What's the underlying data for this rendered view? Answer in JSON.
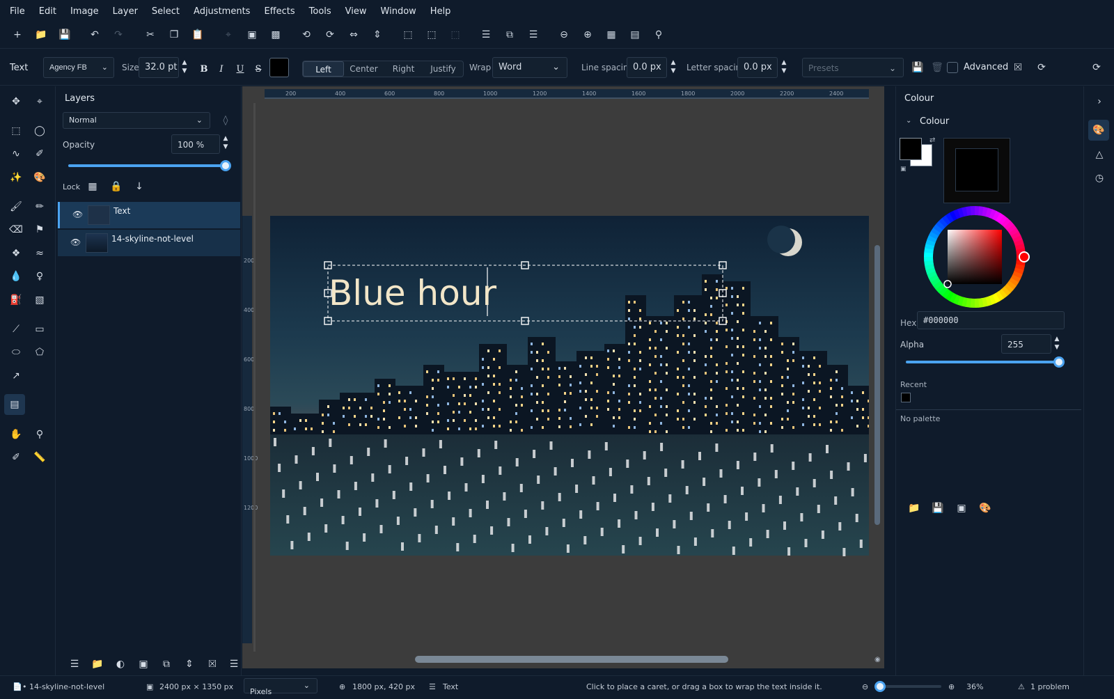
{
  "menu": [
    "File",
    "Edit",
    "Image",
    "Layer",
    "Select",
    "Adjustments",
    "Effects",
    "Tools",
    "View",
    "Window",
    "Help"
  ],
  "options": {
    "tool_label": "Text",
    "font": "Agency FB",
    "size_label": "Size",
    "size_value": "32.0 pt",
    "align": [
      "Left",
      "Center",
      "Right",
      "Justify"
    ],
    "wrap_label": "Wrap",
    "wrap_value": "Word",
    "line_spacing_label": "Line spacing",
    "line_spacing_value": "0.0 px",
    "letter_spacing_label": "Letter spacing",
    "letter_spacing_value": "0.0 px",
    "presets_placeholder": "Presets",
    "advanced_label": "Advanced"
  },
  "layers": {
    "title": "Layers",
    "blend_mode": "Normal",
    "opacity_label": "Opacity",
    "opacity_value": "100 %",
    "opacity_fraction": 1.0,
    "lock_label": "Lock",
    "items": [
      {
        "name": "Text"
      },
      {
        "name": "14-skyline-not-level"
      }
    ]
  },
  "ruler": {
    "h": [
      "200",
      "400",
      "600",
      "800",
      "1000",
      "1200",
      "1400",
      "1600",
      "1800",
      "2000",
      "2200",
      "2400"
    ],
    "v": [
      "200",
      "400",
      "600",
      "800",
      "1000",
      "1200"
    ]
  },
  "canvas_text": "Blue hour",
  "colour": {
    "panel_title": "Colour",
    "section_title": "Colour",
    "hex_label": "Hex",
    "hex_value": "#000000",
    "alpha_label": "Alpha",
    "alpha_value": "255",
    "recent_label": "Recent",
    "no_palette": "No palette",
    "primary": "#000000",
    "secondary": "#ffffff"
  },
  "status": {
    "document": "• 14-skyline-not-level",
    "dimensions": "2400 px × 1350 px",
    "units": "Pixels",
    "cursor": "1800 px, 420 px",
    "layer": "Text",
    "hint": "Click to place a caret, or drag a box to wrap the text inside it.",
    "zoom": "36%",
    "problems": "1 problem"
  }
}
